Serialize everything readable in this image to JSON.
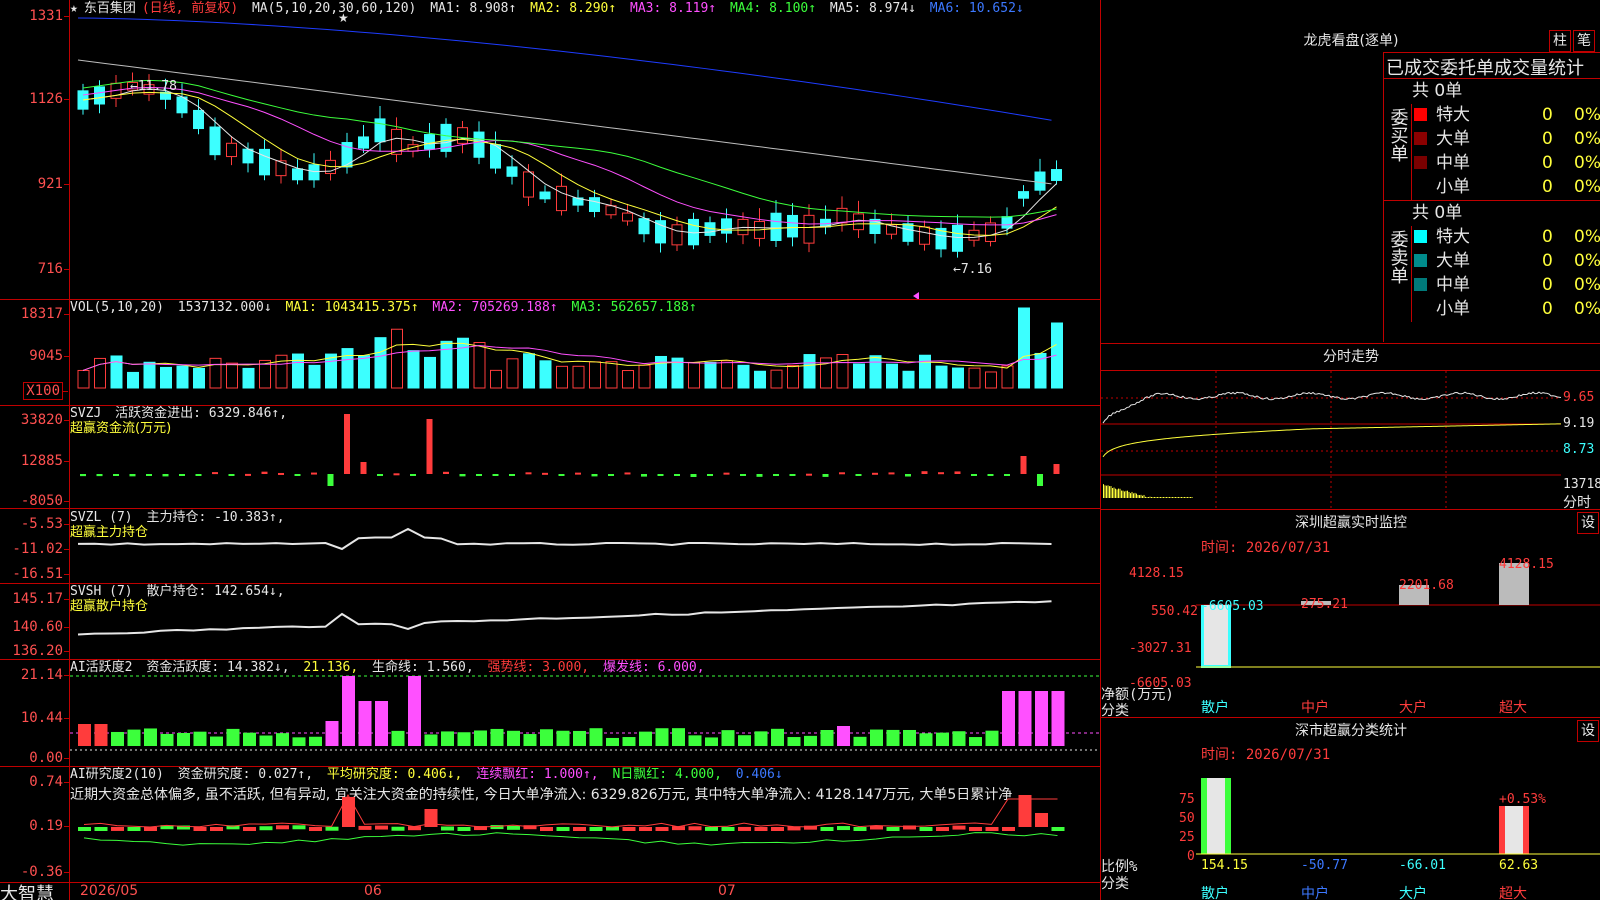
{
  "stock": {
    "name": "东百集团",
    "period": "(日线, 前复权)",
    "star": "★",
    "star_prefix": "★"
  },
  "main_chart": {
    "y_labels": [
      "1331",
      "1126",
      "921",
      "716"
    ],
    "ma_legend": {
      "params": "MA(5,10,20,30,60,120)",
      "ma1": "MA1: 8.908↑",
      "ma2": "MA2: 8.290↑",
      "ma3": "MA3: 8.119↑",
      "ma4": "MA4: 8.100↑",
      "ma5": "MA5: 8.974↓",
      "ma6": "MA6: 10.652↓"
    },
    "high_marker": "←11.78",
    "low_marker": "←7.16"
  },
  "vol_panel": {
    "y_labels": [
      "18317",
      "9045",
      "X100"
    ],
    "legend": {
      "params": "VOL(5,10,20)",
      "vol": "1537132.000↓",
      "ma1": "MA1: 1043415.375↑",
      "ma2": "MA2: 705269.188↑",
      "ma3": "MA3: 562657.188↑"
    }
  },
  "svzj_panel": {
    "y_labels": [
      "33820",
      "12885",
      "-8050"
    ],
    "legend": {
      "params": "SVZJ",
      "label": "活跃资金进出: 6329.846↑,"
    },
    "subtitle": "超赢资金流(万元)"
  },
  "svzl_panel": {
    "y_labels": [
      "-5.53",
      "-11.02",
      "-16.51"
    ],
    "legend": {
      "params": "SVZL (7)",
      "label": "主力持仓: -10.383↑,"
    },
    "subtitle": "超赢主力持仓"
  },
  "svsh_panel": {
    "y_labels": [
      "145.17",
      "140.60",
      "136.20"
    ],
    "legend": {
      "params": "SVSH (7)",
      "label": "散户持仓: 142.654↓,"
    },
    "subtitle": "超赢散户持仓"
  },
  "ai_active_panel": {
    "y_labels": [
      "21.14",
      "10.44",
      "0.00"
    ],
    "legend": {
      "params": "AI活跃度2",
      "label": "资金活跃度: 14.382↓,",
      "v2": "21.136,",
      "life": "生命线: 1.560,",
      "strong": "强势线: 3.000,",
      "burst": "爆发线: 6.000,"
    }
  },
  "ai_research_panel": {
    "y_labels": [
      "0.74",
      "0.19",
      "-0.36"
    ],
    "legend": {
      "params": "AI研究度2(10)",
      "label": "资金研究度: 0.027↑,",
      "avg": "平均研究度: 0.406↓,",
      "red": "连续飘红: 1.000↑,",
      "nred": "N日飘红: 4.000,",
      "v": "0.406↓"
    },
    "commentary": "近期大资金总体偏多, 虽不活跃, 但有异动, 宜关注大资金的持续性, 今日大单净流入: 6329.826万元, 其中特大单净流入: 4128.147万元, 大单5日累计净"
  },
  "dates": [
    "2026/05",
    "06",
    "07"
  ],
  "brand": "大智慧",
  "tiger": {
    "title": "龙虎看盘(逐单)",
    "tab_col": "柱",
    "tab_pen": "笔",
    "header": "已成交委托单成交量统计",
    "buy_side": "委买单",
    "sell_side": "委卖单",
    "buy_total": "共 0单",
    "sell_total": "共 0单",
    "buy_rows": [
      {
        "name": "特大",
        "count": "0",
        "pct": "0%",
        "color": "#ff0000"
      },
      {
        "name": "大单",
        "count": "0",
        "pct": "0%",
        "color": "#8b0000"
      },
      {
        "name": "中单",
        "count": "0",
        "pct": "0%",
        "color": "#7a0000"
      },
      {
        "name": "小单",
        "count": "0",
        "pct": "0%",
        "color": "#000000"
      }
    ],
    "sell_rows": [
      {
        "name": "特大",
        "count": "0",
        "pct": "0%",
        "color": "#00ffff"
      },
      {
        "name": "大单",
        "count": "0",
        "pct": "0%",
        "color": "#008b8b"
      },
      {
        "name": "中单",
        "count": "0",
        "pct": "0%",
        "color": "#007a7a"
      },
      {
        "name": "小单",
        "count": "0",
        "pct": "0%",
        "color": "#000000"
      }
    ]
  },
  "intraday": {
    "title": "分时走势",
    "y_labels": [
      "9.65",
      "9.19",
      "8.73"
    ],
    "vol_label": "13718",
    "footer": "分时"
  },
  "sz_monitor": {
    "title": "深圳超赢实时监控",
    "set": "设",
    "time": "时间: 2026/07/31",
    "y_labels": [
      "4128.15",
      "550.42",
      "-3027.31",
      "-6605.03"
    ],
    "unit": "净额(万元)",
    "cat_label": "分类",
    "categories": [
      "散户",
      "中户",
      "大户",
      "超大"
    ],
    "values": [
      "-6605.03",
      "275.21",
      "2201.68",
      "4128.15"
    ]
  },
  "sz_class": {
    "title": "深市超赢分类统计",
    "set": "设",
    "time": "时间: 2026/07/31",
    "y_labels": [
      "75",
      "50",
      "25",
      "0"
    ],
    "unit": "比例%",
    "cat_label": "分类",
    "categories": [
      "散户",
      "中户",
      "大户",
      "超大"
    ],
    "values": [
      "154.15",
      "-50.77",
      "-66.01",
      "62.63"
    ],
    "annotation": "+0.53%"
  }
}
